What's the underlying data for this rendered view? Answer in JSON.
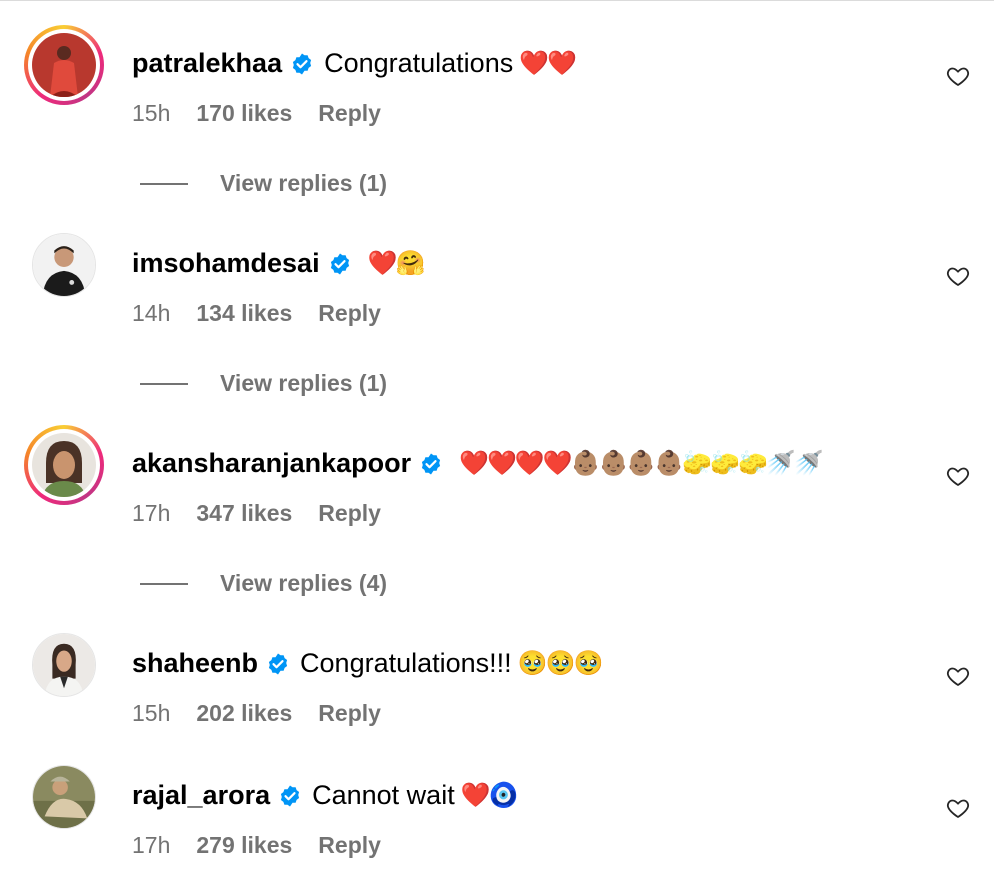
{
  "comments": [
    {
      "username": "patralekhaa",
      "verified": true,
      "text": "Congratulations",
      "emojis": "❤️❤️",
      "time": "15h",
      "likes": "170 likes",
      "reply": "Reply",
      "view_replies": "View replies (1)",
      "avatar": {
        "style": "story-ring",
        "colors": {
          "bg": "#b8382e",
          "figure": "#e04a3c"
        }
      }
    },
    {
      "username": "imsohamdesai",
      "verified": true,
      "text": "",
      "emojis": "❤️🤗",
      "time": "14h",
      "likes": "134 likes",
      "reply": "Reply",
      "view_replies": "View replies (1)",
      "avatar": {
        "style": "plain",
        "colors": {
          "bg": "#f2f2f2",
          "figure": "#1b1b1b"
        }
      }
    },
    {
      "username": "akansharanjankapoor",
      "verified": true,
      "text": "",
      "emojis": "❤️❤️❤️❤️👶🏽👶🏽👶🏽👶🏽🧽🧽🧽🚿🚿",
      "time": "17h",
      "likes": "347 likes",
      "reply": "Reply",
      "view_replies": "View replies (4)",
      "avatar": {
        "style": "story-ring",
        "colors": {
          "bg": "#e8e4de",
          "figure": "#6a4a3a"
        }
      }
    },
    {
      "username": "shaheenb",
      "verified": true,
      "text": "Congratulations!!! ",
      "emojis": "🥹🥹🥹",
      "time": "15h",
      "likes": "202 likes",
      "reply": "Reply",
      "view_replies": "",
      "avatar": {
        "style": "plain",
        "colors": {
          "bg": "#ece9e6",
          "figure": "#3a2a22"
        }
      }
    },
    {
      "username": "rajal_arora",
      "verified": true,
      "text": "Cannot wait ",
      "emojis": "❤️🧿",
      "time": "17h",
      "likes": "279 likes",
      "reply": "Reply",
      "view_replies": "",
      "avatar": {
        "style": "plain",
        "colors": {
          "bg": "#8a8a60",
          "figure": "#d9c9a8"
        }
      }
    }
  ],
  "icons": {
    "verified": "verified-badge-icon",
    "like": "heart-outline-icon"
  },
  "colors": {
    "verified_blue": "#0095f6",
    "secondary_text": "#737373"
  }
}
